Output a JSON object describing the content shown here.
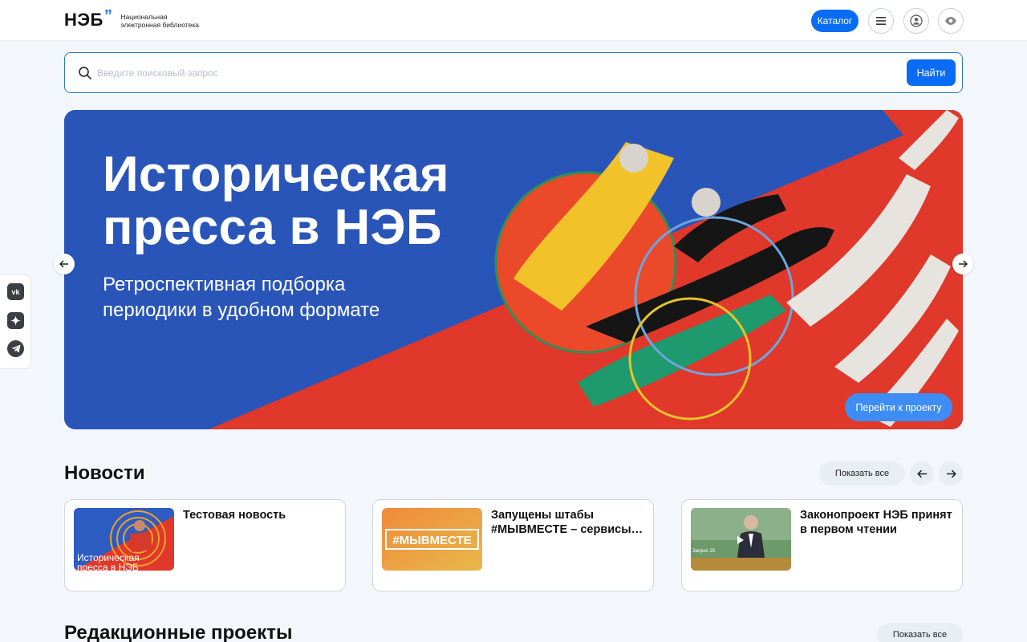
{
  "header": {
    "logo_mark": "НЭБ",
    "logo_line1": "Национальная",
    "logo_line2": "электронная библиотека",
    "catalog_label": "Каталог"
  },
  "search": {
    "placeholder": "Введите поисковый запрос",
    "value": "",
    "button_label": "Найти"
  },
  "banner": {
    "title_line1": "Историческая",
    "title_line2": "пресса в НЭБ",
    "subtitle_line1": "Ретроспективная подборка",
    "subtitle_line2": "периодики в удобном формате",
    "cta_label": "Перейти к проекту"
  },
  "social": {
    "items": [
      {
        "icon": "vk-icon"
      },
      {
        "icon": "dzen-icon"
      },
      {
        "icon": "telegram-icon"
      }
    ]
  },
  "news": {
    "heading": "Новости",
    "show_all_label": "Показать все",
    "items": [
      {
        "title": "Тестовая новость",
        "thumb_text_line1": "Историческая",
        "thumb_text_line2": "пресса в НЭБ"
      },
      {
        "title": "Запущены штабы #МЫВМЕСТЕ – сервисы помощи",
        "thumb_text_line1": "#МЫВМЕСТЕ"
      },
      {
        "title": "Законопроект НЭБ принят в первом чтении",
        "thumb_text_line1": "Запрос 25"
      }
    ]
  },
  "projects": {
    "heading": "Редакционные проекты",
    "show_all_label": "Показать все"
  },
  "colors": {
    "accent": "#0a6cf5",
    "banner_blue": "#2a55b8",
    "banner_red": "#e0382a",
    "page_bg": "#f3f7fb"
  }
}
